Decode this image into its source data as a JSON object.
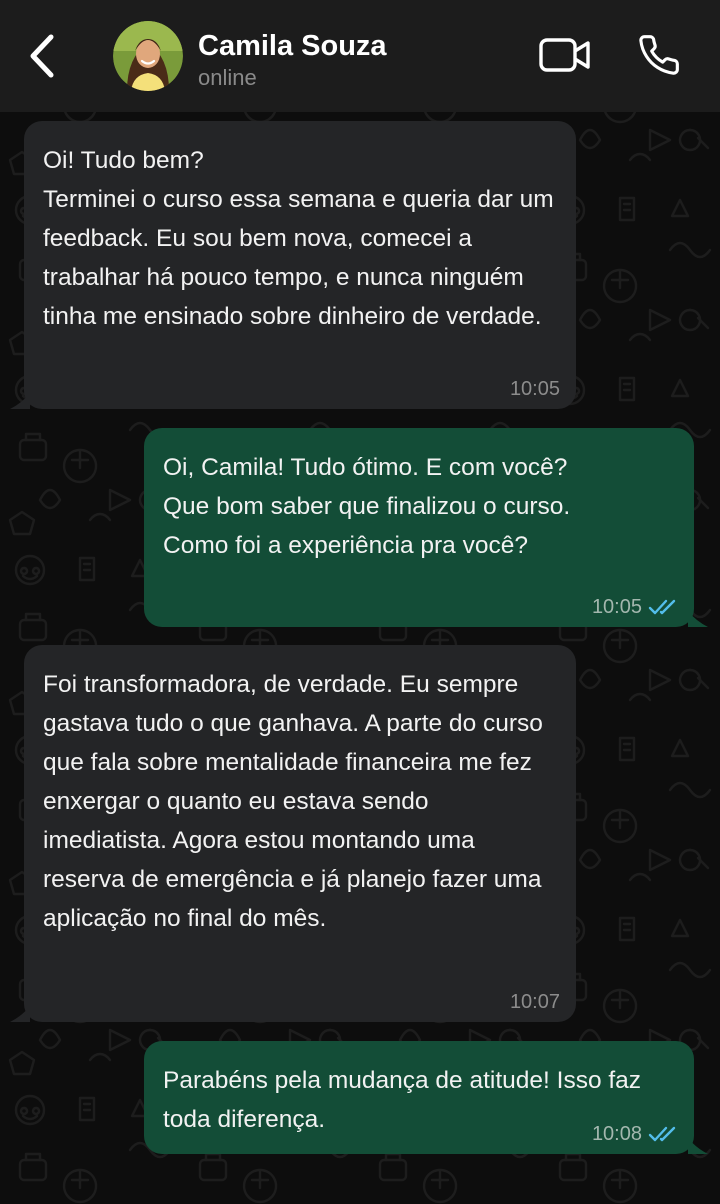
{
  "header": {
    "contact_name": "Camila Souza",
    "status": "online",
    "icons": {
      "back": "chevron-left-icon",
      "video": "video-camera-icon",
      "call": "phone-icon"
    }
  },
  "colors": {
    "header_bg": "#1c1c1c",
    "chat_bg": "#0d0d0d",
    "incoming_bubble": "#242527",
    "outgoing_bubble": "#134d37",
    "read_ticks": "#53bdeb"
  },
  "messages": [
    {
      "direction": "incoming",
      "text": "Oi! Tudo bem?\nTerminei o curso essa semana e queria dar um feedback. Eu sou bem nova, comecei a trabalhar há pouco tempo, e nunca ninguém tinha me ensinado sobre dinheiro de verdade.",
      "time": "10:05"
    },
    {
      "direction": "outgoing",
      "text": "Oi, Camila! Tudo ótimo. E com você?\nQue bom saber que finalizou o curso.\nComo foi a experiência pra você?",
      "time": "10:05",
      "status": "read"
    },
    {
      "direction": "incoming",
      "text": "Foi transformadora, de verdade. Eu sempre gastava tudo o que ganhava. A parte do curso que fala sobre mentalidade financeira me fez enxergar o quanto eu estava sendo imediatista. Agora estou montando uma reserva de emergência e já planejo fazer uma aplicação no final do mês.",
      "time": "10:07"
    },
    {
      "direction": "outgoing",
      "text": "Parabéns pela mudança de atitude! Isso faz toda diferença.",
      "time": "10:08",
      "status": "read"
    }
  ]
}
